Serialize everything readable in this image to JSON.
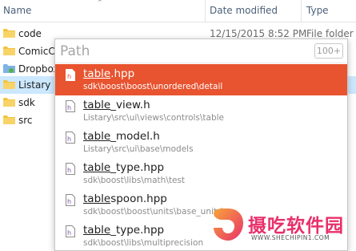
{
  "explorer": {
    "columns": {
      "name": "Name",
      "date": "Date modified",
      "type": "Type"
    },
    "rows": [
      {
        "name": "code",
        "date": "12/15/2015 8:52 PM",
        "type": "File folder",
        "icon": "folder-icon"
      },
      {
        "name": "ComicCo",
        "date": "",
        "type": "",
        "icon": "folder-icon"
      },
      {
        "name": "Dropbox",
        "date": "",
        "type": "",
        "icon": "dropbox-icon"
      },
      {
        "name": "Listary",
        "date": "",
        "type": "",
        "icon": "folder-icon",
        "selected": true
      },
      {
        "name": "sdk",
        "date": "",
        "type": "",
        "icon": "folder-icon"
      },
      {
        "name": "src",
        "date": "",
        "type": "",
        "icon": "folder-icon"
      }
    ]
  },
  "popup": {
    "search_placeholder": "Path",
    "count": "100+",
    "results": [
      {
        "name_match": "table",
        "name_rest": ".hpp",
        "path": "sdk\\boost\\boost\\unordered\\detail",
        "active": true
      },
      {
        "name_match": "table",
        "name_rest": "_view.h",
        "path": "Listary\\src\\ui\\views\\controls\\table"
      },
      {
        "name_match": "table",
        "name_rest": "_model.h",
        "path": "Listary\\src\\ui\\base\\models"
      },
      {
        "name_match": "table",
        "name_rest": "_type.hpp",
        "path": "sdk\\boost\\libs\\math\\test"
      },
      {
        "name_match": "table",
        "name_rest": "spoon.hpp",
        "path": "sdk\\boost\\boost\\units\\base_units\\us"
      },
      {
        "name_match": "table",
        "name_rest": "_type.hpp",
        "path": "sdk\\boost\\libs\\multiprecision"
      }
    ]
  },
  "watermark": {
    "text": "摄吃软件园",
    "url": "WWW.SHECHIPIN1.COM"
  },
  "colors": {
    "accent": "#e85330",
    "selection": "#cce8ff",
    "folder": "#f4c23d",
    "watermark": "#e8306a"
  }
}
